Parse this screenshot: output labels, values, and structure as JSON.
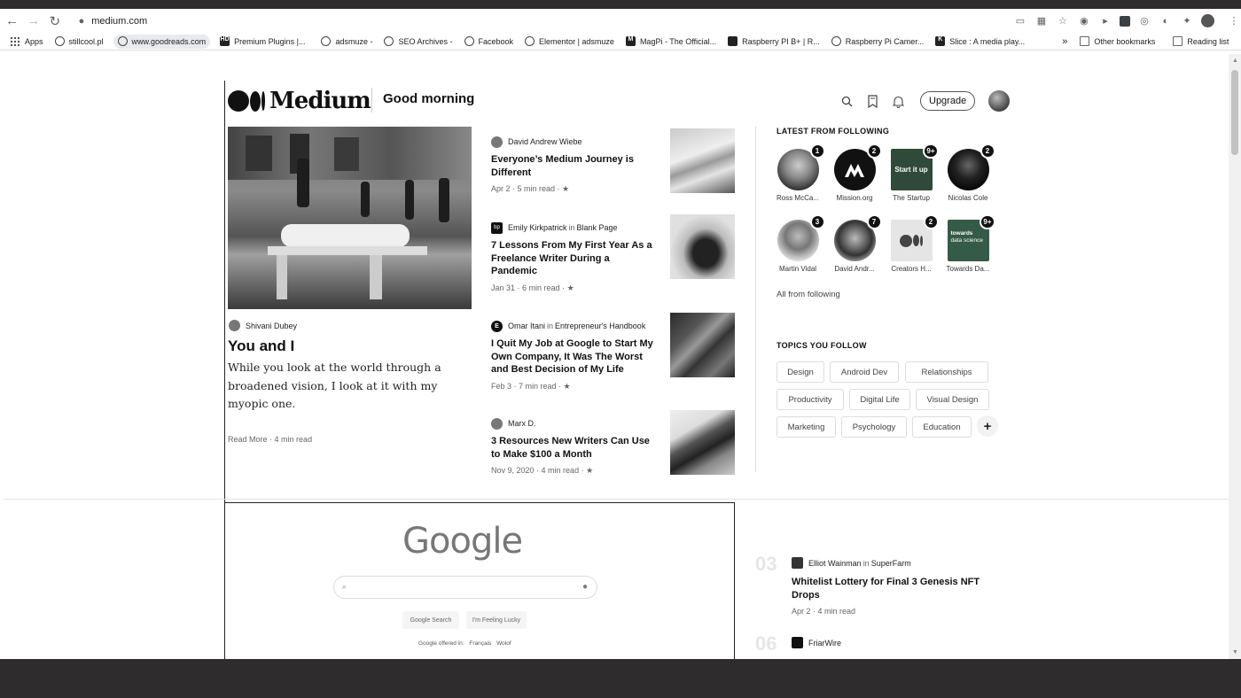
{
  "browser": {
    "url": "medium.com",
    "bookmarks": [
      "Apps",
      "stillcool.pl",
      "www.goodreads.com",
      "Premium Plugins |...",
      "adsmuze -",
      "SEO Archives -",
      "Facebook",
      "Elementor | adsmuze",
      "MagPi - The Official...",
      "Raspberry PI B+ | R...",
      "Raspberry Pi Camer...",
      "Slice : A media play..."
    ],
    "bookmarks_overflow": "»",
    "other_bookmarks": "Other bookmarks",
    "reading_list": "Reading list"
  },
  "header": {
    "logo_text": "Medium",
    "greeting": "Good morning",
    "upgrade_label": "Upgrade"
  },
  "featured": {
    "author": "Shivani Dubey",
    "title": "You and I",
    "subtitle": "While you look at the world through a broadened vision, I look at it with my myopic one.",
    "read_more": "Read More",
    "read_time": "4 min read"
  },
  "stories": [
    {
      "author": "David Andrew Wiebe",
      "pub": "",
      "title": "Everyone’s Medium Journey is Different",
      "date": "Apr 2",
      "read": "5 min read"
    },
    {
      "author": "Emily Kirkpatrick",
      "pub": "Blank Page",
      "title": "7 Lessons From My First Year As a Freelance Writer During a Pandemic",
      "date": "Jan 31",
      "read": "6 min read"
    },
    {
      "author": "Omar Itani",
      "pub": "Entrepreneur's Handbook",
      "title": "I Quit My Job at Google to Start My Own Company, It Was The Worst and Best Decision of My Life",
      "date": "Feb 3",
      "read": "7 min read"
    },
    {
      "author": "Marx D.",
      "pub": "",
      "title": "3 Resources New Writers Can Use to Make $100 a Month",
      "date": "Nov 9, 2020",
      "read": "4 min read"
    }
  ],
  "in_label": "in",
  "star": "★",
  "latest": {
    "heading": "LATEST FROM FOLLOWING",
    "items": [
      {
        "name": "Ross McCa...",
        "badge": "1"
      },
      {
        "name": "Mission.org",
        "badge": "2"
      },
      {
        "name": "The Startup",
        "badge": "9+",
        "logo": "Start it up"
      },
      {
        "name": "Nicolas Cole",
        "badge": "2"
      },
      {
        "name": "Martin Vidal",
        "badge": "3"
      },
      {
        "name": "David Andr...",
        "badge": "7"
      },
      {
        "name": "Creators H...",
        "badge": "2"
      },
      {
        "name": "Towards Da...",
        "badge": "9+",
        "logo1": "towards",
        "logo2": "data science"
      }
    ],
    "all_link": "All from following"
  },
  "topics": {
    "heading": "TOPICS YOU FOLLOW",
    "items": [
      "Design",
      "Android Dev",
      "Relationships",
      "Productivity",
      "Digital Life",
      "Visual Design",
      "Marketing",
      "Psychology",
      "Education"
    ],
    "more": "+"
  },
  "google": {
    "logo": "Google",
    "btn_search": "Google Search",
    "btn_lucky": "I'm Feeling Lucky",
    "offered": "Google offered in:",
    "lang1": "Français",
    "lang2": "Wolof"
  },
  "trending": [
    {
      "num": "03",
      "author": "Elliot Wainman",
      "pub": "SuperFarm",
      "title": "Whitelist Lottery for Final 3 Genesis NFT Drops",
      "date": "Apr 2",
      "read": "4 min read"
    },
    {
      "num": "06",
      "author": "FriarWire",
      "pub": ""
    }
  ],
  "icons": {
    "back": "←",
    "forward": "→",
    "reload": "↻",
    "lock": "🔒",
    "search": "⌕",
    "bookmark": "🔖",
    "bell": "🔔",
    "mic": "🎙"
  }
}
